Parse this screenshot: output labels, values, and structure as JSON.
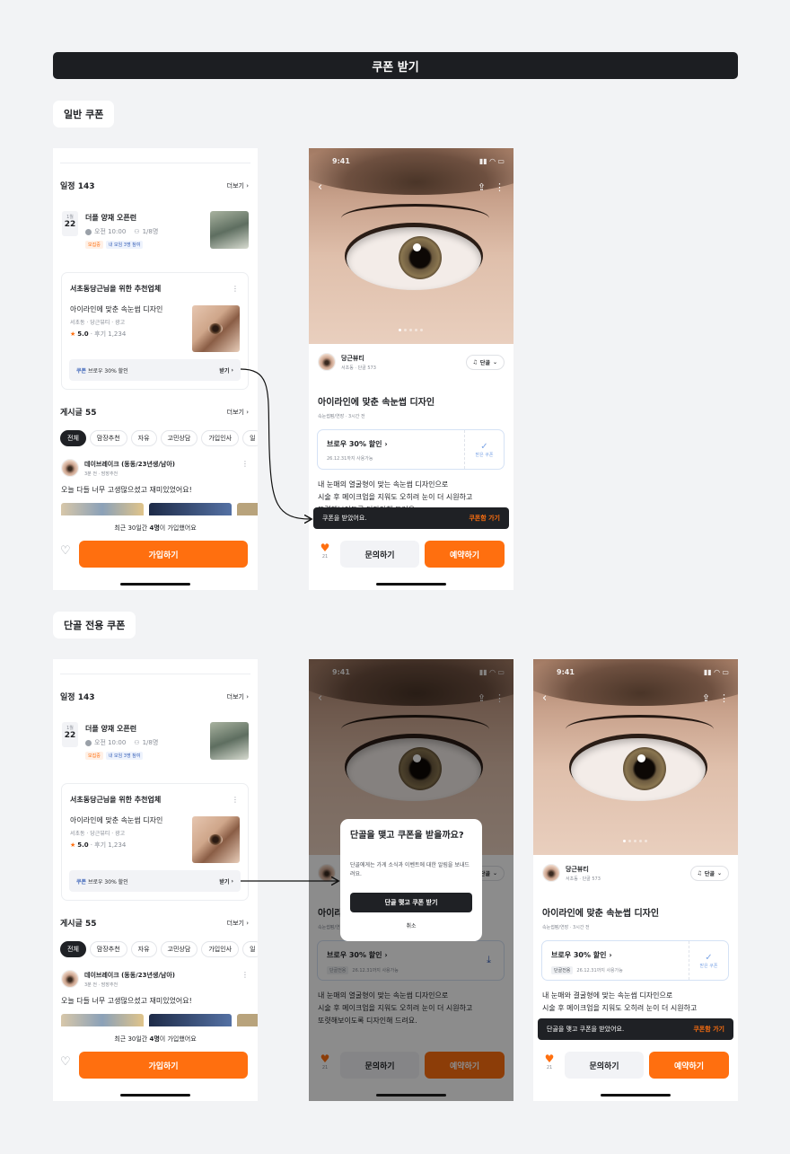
{
  "header": {
    "title": "쿠폰 받기"
  },
  "sections": {
    "normal": "일반 쿠폰",
    "regular": "단골 전용 쿠폰"
  },
  "feed": {
    "schedule_title": "일정 143",
    "more": "더보기",
    "event": {
      "month": "1월",
      "day": "22",
      "name": "더플 양재 오픈런",
      "time": "오전 10:00",
      "count": "1/8명",
      "badge_open": "모집중",
      "badge_friends": "내 모임 3명 참여"
    },
    "rec_title": "서초동당근님을 위한 추천업체",
    "rec_item": {
      "title": "아이라인에 맞춘 속눈썹 디자인",
      "meta": "서초동 · 당근뷰티 · 광고",
      "rating": "5.0",
      "reviews": "· 후기 1,234"
    },
    "coupon": {
      "tag": "쿠폰",
      "text": "브로우 30% 할인",
      "action": "받기"
    },
    "posts_title": "게시글 55",
    "chips": [
      "전체",
      "맘장추천",
      "자유",
      "고민상담",
      "가입인사",
      "일"
    ],
    "post": {
      "author": "데이브레이크 (동동/23년생/남아)",
      "meta": "3분 전 · 맘장추천",
      "text": "오늘 다들 너무 고생많으셨고 재미있었어요!"
    },
    "join_info_pre": "최근 30일간 ",
    "join_info_bold": "4명",
    "join_info_post": "이 가입했어요",
    "join_button": "가입하기"
  },
  "detail": {
    "status_time": "9:41",
    "shop_name": "당근뷰티",
    "shop_meta_1": "서초동 · 단골 573",
    "shop_meta_2": "서초동 · 단골 573",
    "regular_button": "단골",
    "title": "아이라인에 맞춘 속눈썹 디자인",
    "category_1": "속눈썹펌/연장 · 3시간 전",
    "category_2": "속눈썹펌/연장 · 3시간 전",
    "coupon_title": "브로우 30% 할인",
    "coupon_validity": "26.12.31까지 사용가능",
    "coupon_regular_tag": "단골전용",
    "coupon_validity_dim": "26.12.31까지 사용가능",
    "coupon_received": "받은 쿠폰",
    "body_line1": "내 눈매의 열굴형이 맞는 속눈썹 디자인으로",
    "body_line2": "시술 후 메이크업을 지워도 오히려 눈이 더 시원하고",
    "body_line3": "또렷해보이도록 디자인해 드려요.",
    "body_line1_alt": "내 눈매와 결굴형에 맞는 속눈썹 디자인으로",
    "toast_text": "쿠폰을 받았어요.",
    "toast_action": "쿠폰함 가기",
    "toast_text_regular": "단골을 맺고 쿠폰을 받았어요.",
    "like_count": "21",
    "inquire": "문의하기",
    "reserve": "예약하기"
  },
  "modal": {
    "title": "단골을 맺고 쿠폰을 받을까요?",
    "desc": "단골에게는 가게 소식과 이벤트에 대한 알림을 보내드려요.",
    "confirm": "단골 맺고 쿠폰 받기",
    "cancel": "취소"
  },
  "colors": {
    "accent": "#ff6f0f",
    "dark": "#1f2125",
    "background": "#f2f3f5"
  }
}
